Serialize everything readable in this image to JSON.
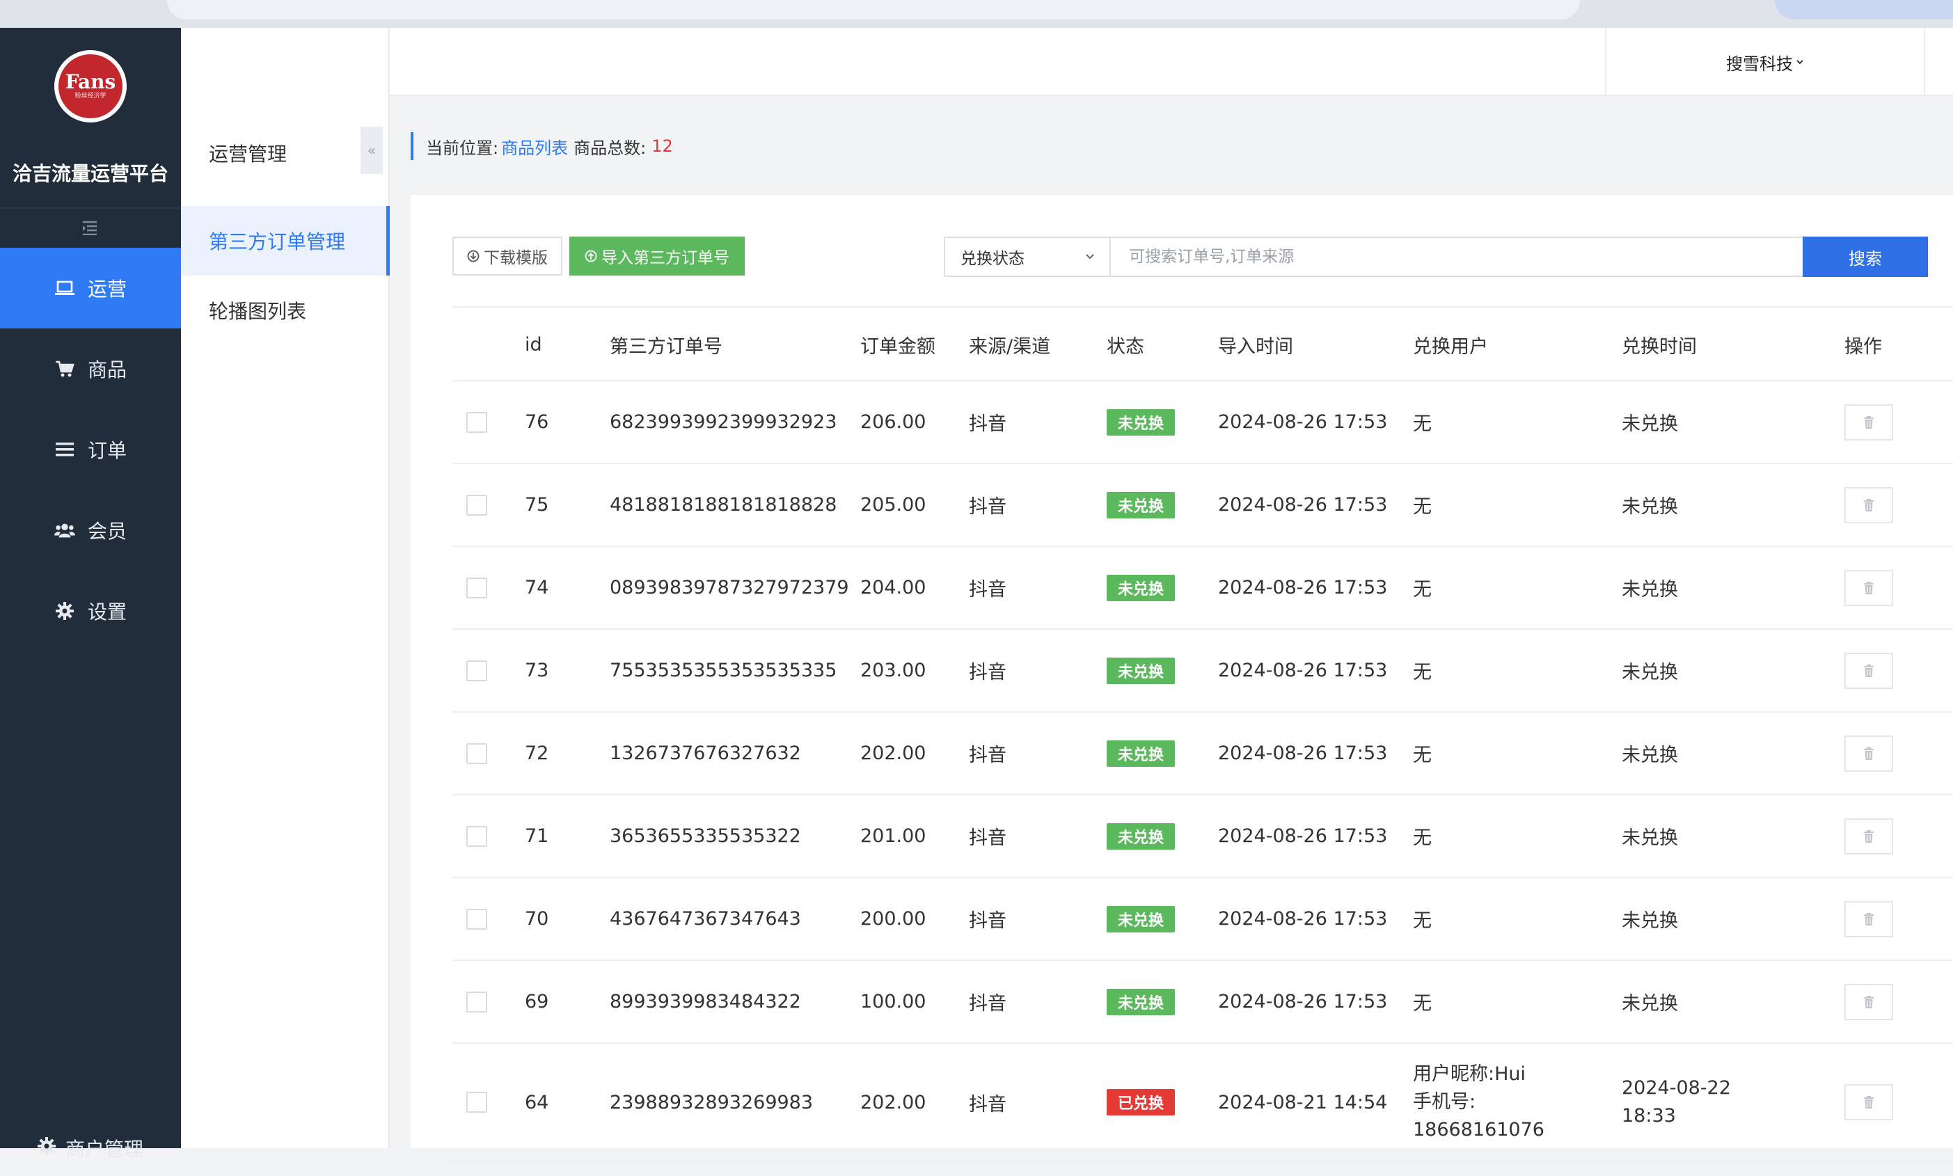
{
  "sidebar": {
    "logo_text": "Fans",
    "logo_sub": "粉丝经济学",
    "brand": "洽吉流量运营平台",
    "items": [
      {
        "label": "运营",
        "icon": "laptop-icon",
        "active": true
      },
      {
        "label": "商品",
        "icon": "cart-icon",
        "active": false
      },
      {
        "label": "订单",
        "icon": "list-icon",
        "active": false
      },
      {
        "label": "会员",
        "icon": "users-icon",
        "active": false
      },
      {
        "label": "设置",
        "icon": "gear-icon",
        "active": false
      }
    ],
    "merchant_label": "商户管理"
  },
  "subnav": {
    "title": "运营管理",
    "items": [
      {
        "label": "第三方订单管理",
        "active": true
      },
      {
        "label": "轮播图列表",
        "active": false
      }
    ]
  },
  "header": {
    "user": "搜雪科技"
  },
  "breadcrumb": {
    "prefix": "当前位置:",
    "link": "商品列表",
    "count_label": "商品总数:",
    "count": "12"
  },
  "toolbar": {
    "download_label": "下载模版",
    "import_label": "导入第三方订单号",
    "status_select": "兑换状态",
    "search_placeholder": "可搜索订单号,订单来源",
    "search_label": "搜索"
  },
  "table": {
    "headers": [
      "id",
      "第三方订单号",
      "订单金额",
      "来源/渠道",
      "状态",
      "导入时间",
      "兑换用户",
      "兑换时间",
      "操作"
    ],
    "rows": [
      {
        "id": "76",
        "order_no": "6823993992399932923",
        "amount": "206.00",
        "source": "抖音",
        "status": "未兑换",
        "import_time": "2024-08-26 17:53",
        "user": "无",
        "exchange_time": "未兑换"
      },
      {
        "id": "75",
        "order_no": "4818818188181818828",
        "amount": "205.00",
        "source": "抖音",
        "status": "未兑换",
        "import_time": "2024-08-26 17:53",
        "user": "无",
        "exchange_time": "未兑换"
      },
      {
        "id": "74",
        "order_no": "08939839787327972379",
        "amount": "204.00",
        "source": "抖音",
        "status": "未兑换",
        "import_time": "2024-08-26 17:53",
        "user": "无",
        "exchange_time": "未兑换"
      },
      {
        "id": "73",
        "order_no": "7553535355353535335",
        "amount": "203.00",
        "source": "抖音",
        "status": "未兑换",
        "import_time": "2024-08-26 17:53",
        "user": "无",
        "exchange_time": "未兑换"
      },
      {
        "id": "72",
        "order_no": "1326737676327632",
        "amount": "202.00",
        "source": "抖音",
        "status": "未兑换",
        "import_time": "2024-08-26 17:53",
        "user": "无",
        "exchange_time": "未兑换"
      },
      {
        "id": "71",
        "order_no": "3653655335535322",
        "amount": "201.00",
        "source": "抖音",
        "status": "未兑换",
        "import_time": "2024-08-26 17:53",
        "user": "无",
        "exchange_time": "未兑换"
      },
      {
        "id": "70",
        "order_no": "4367647367347643",
        "amount": "200.00",
        "source": "抖音",
        "status": "未兑换",
        "import_time": "2024-08-26 17:53",
        "user": "无",
        "exchange_time": "未兑换"
      },
      {
        "id": "69",
        "order_no": "8993939983484322",
        "amount": "100.00",
        "source": "抖音",
        "status": "未兑换",
        "import_time": "2024-08-26 17:53",
        "user": "无",
        "exchange_time": "未兑换"
      }
    ],
    "last_row": {
      "id": "64",
      "order_no": "23988932893269983",
      "amount": "202.00",
      "source": "抖音",
      "status": "已兑换",
      "import_time": "2024-08-21 14:54",
      "user_lines": [
        "用户昵称:Hui",
        "手机号:",
        "18668161076"
      ],
      "exchange_date": "2024-08-22",
      "exchange_clock": "18:33"
    }
  },
  "colors": {
    "accent": "#2f7bf6",
    "sidebar_bg": "#222d3c",
    "badge_pending": "#5cb85c",
    "badge_done": "#e53935",
    "import_btn": "#5cb85c"
  }
}
